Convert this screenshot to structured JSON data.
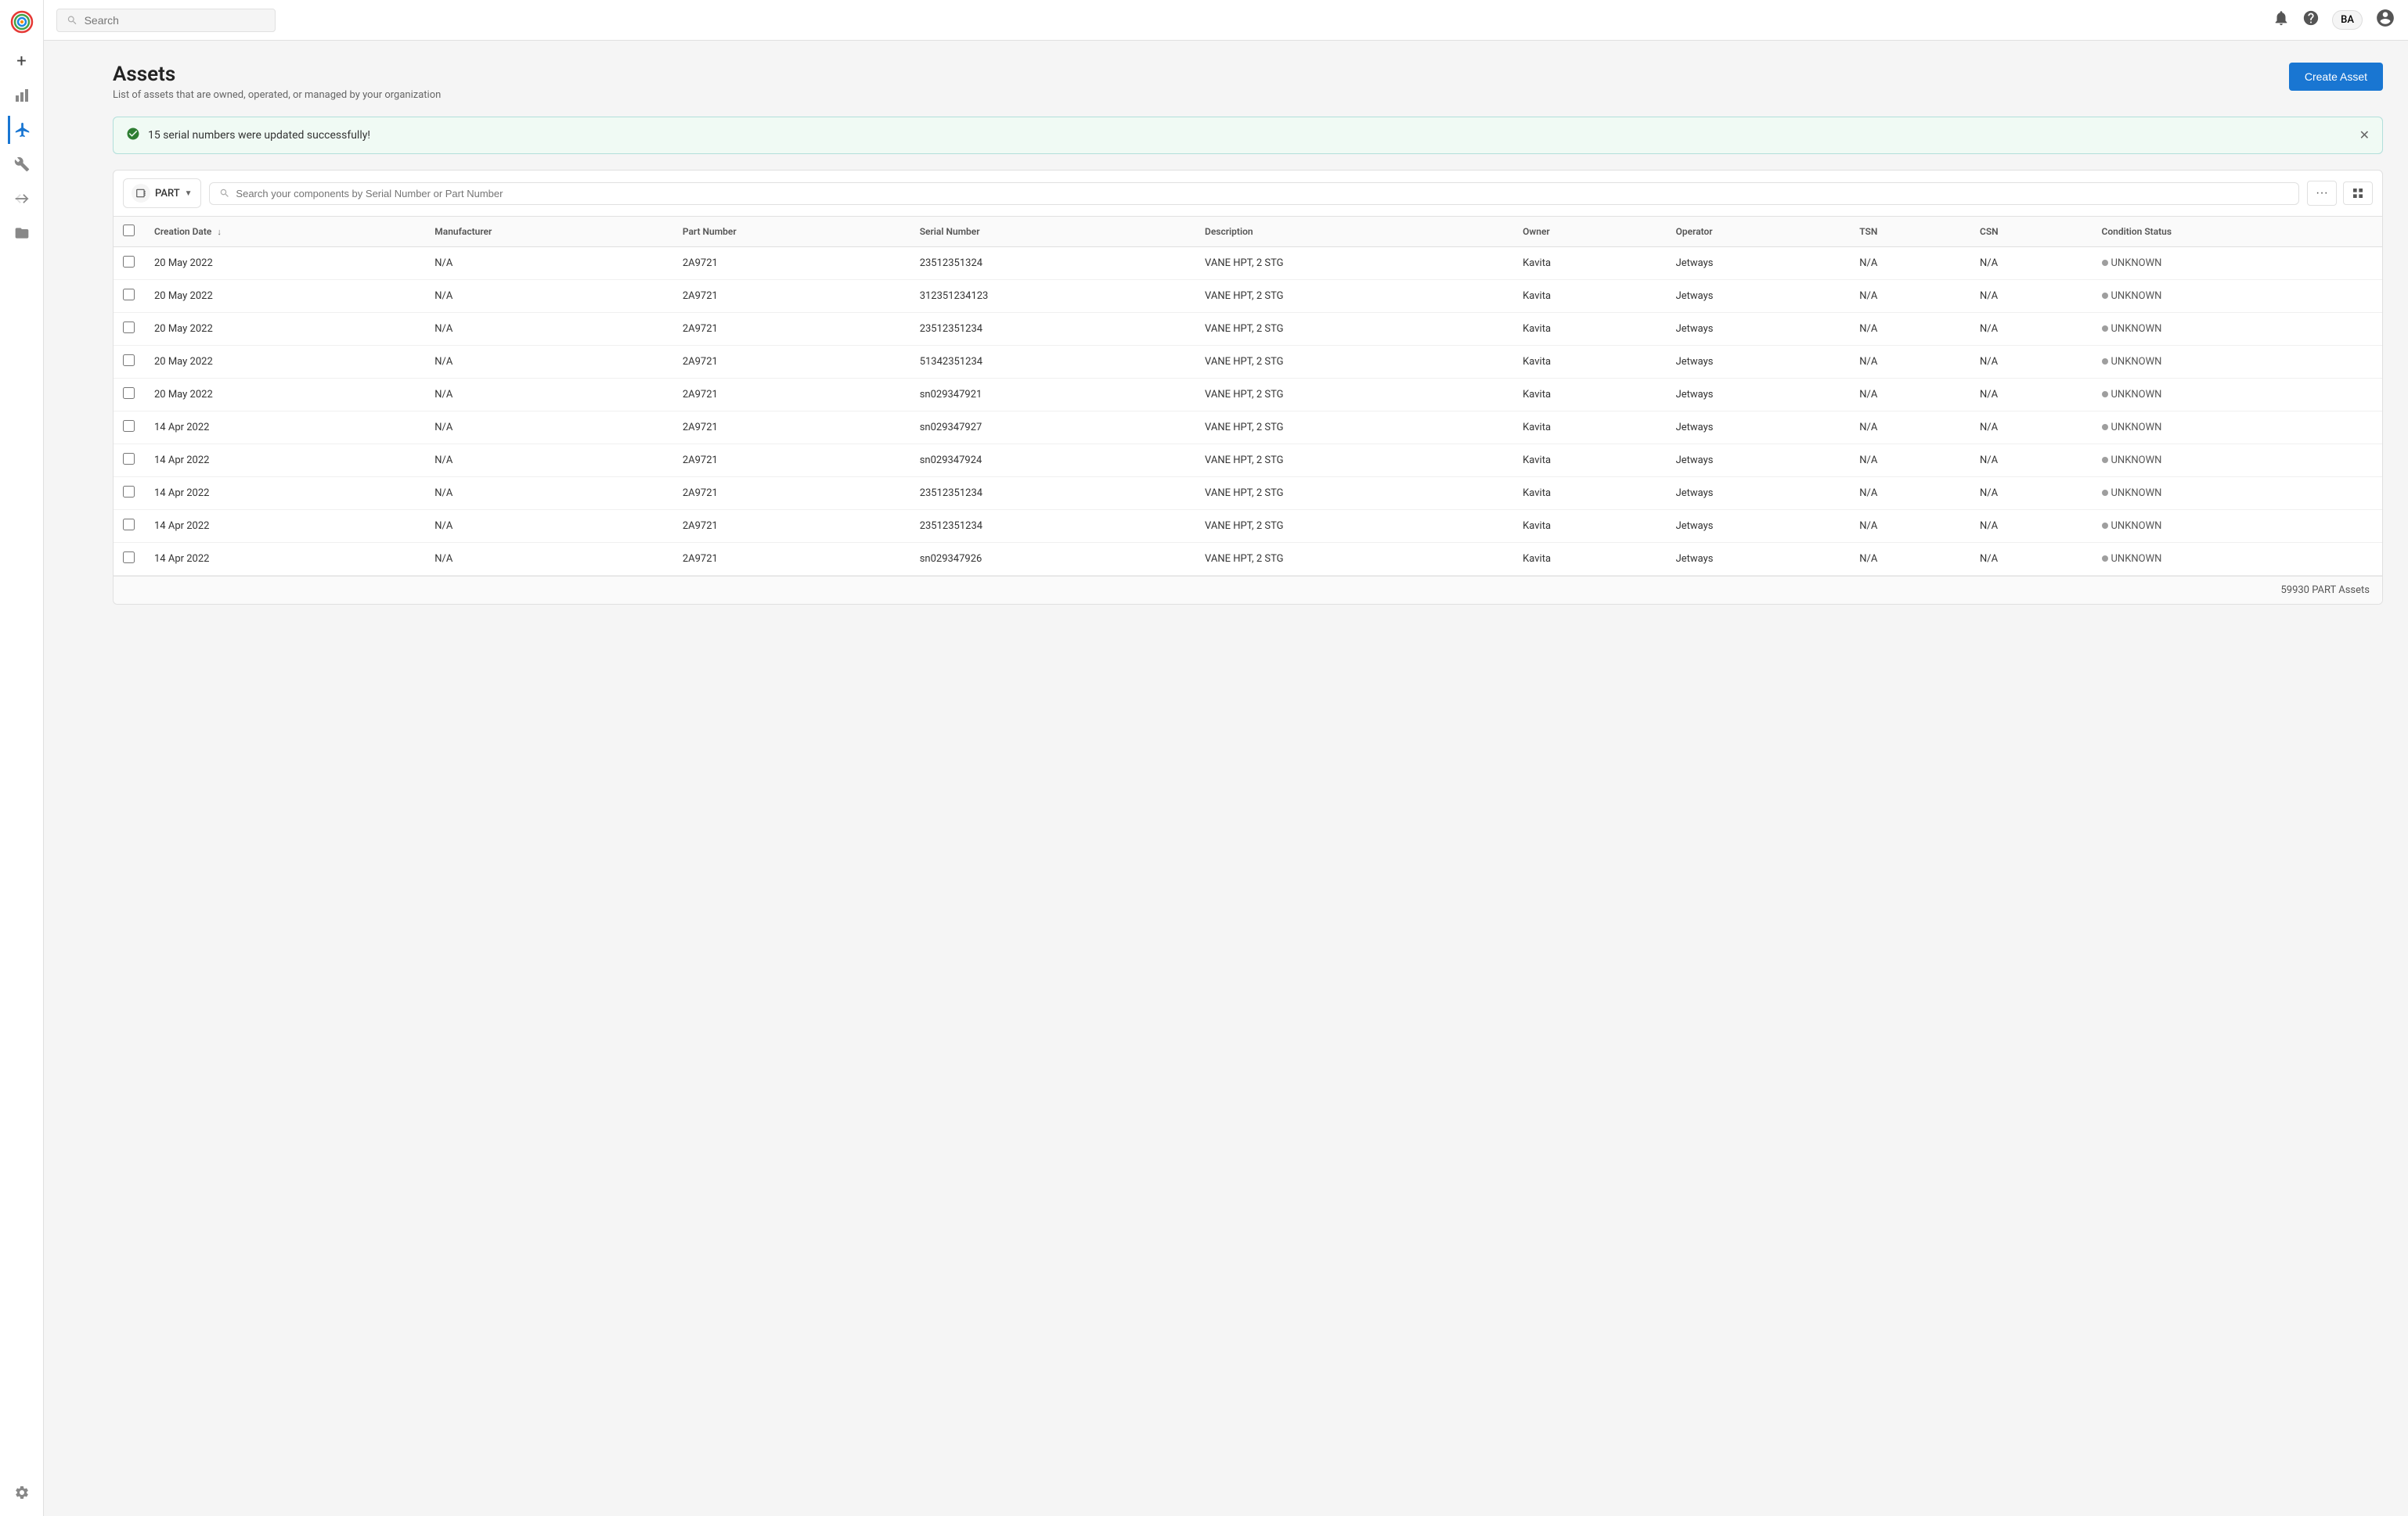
{
  "app": {
    "title": "Assets",
    "subtitle": "List of assets that are owned, operated, or managed by your organization"
  },
  "topbar": {
    "search_placeholder": "Search",
    "user_initials": "BA"
  },
  "sidebar": {
    "items": [
      {
        "id": "add",
        "icon": "+",
        "label": "Add"
      },
      {
        "id": "analytics",
        "icon": "📊",
        "label": "Analytics"
      },
      {
        "id": "flights",
        "icon": "✈",
        "label": "Flights",
        "active": true
      },
      {
        "id": "tools",
        "icon": "🔧",
        "label": "Tools"
      },
      {
        "id": "connections",
        "icon": "⇄",
        "label": "Connections"
      },
      {
        "id": "files",
        "icon": "📁",
        "label": "Files"
      },
      {
        "id": "settings",
        "icon": "⚙",
        "label": "Settings"
      }
    ]
  },
  "create_button": "Create Asset",
  "success_banner": {
    "message": "15 serial numbers were updated successfully!"
  },
  "toolbar": {
    "asset_type": "PART",
    "search_placeholder": "Search your components by Serial Number or Part Number",
    "more_options": "···",
    "view_toggle": "⊞"
  },
  "table": {
    "columns": [
      {
        "id": "creation_date",
        "label": "Creation Date",
        "sortable": true,
        "sort_dir": "desc"
      },
      {
        "id": "manufacturer",
        "label": "Manufacturer"
      },
      {
        "id": "part_number",
        "label": "Part Number"
      },
      {
        "id": "serial_number",
        "label": "Serial Number"
      },
      {
        "id": "description",
        "label": "Description"
      },
      {
        "id": "owner",
        "label": "Owner"
      },
      {
        "id": "operator",
        "label": "Operator"
      },
      {
        "id": "tsn",
        "label": "TSN"
      },
      {
        "id": "csn",
        "label": "CSN"
      },
      {
        "id": "condition_status",
        "label": "Condition Status"
      }
    ],
    "rows": [
      {
        "creation_date": "20 May 2022",
        "manufacturer": "N/A",
        "part_number": "2A9721",
        "serial_number": "23512351324",
        "description": "VANE HPT, 2 STG",
        "owner": "Kavita",
        "operator": "Jetways",
        "tsn": "N/A",
        "csn": "N/A",
        "condition_status": "UNKNOWN"
      },
      {
        "creation_date": "20 May 2022",
        "manufacturer": "N/A",
        "part_number": "2A9721",
        "serial_number": "312351234123",
        "description": "VANE HPT, 2 STG",
        "owner": "Kavita",
        "operator": "Jetways",
        "tsn": "N/A",
        "csn": "N/A",
        "condition_status": "UNKNOWN"
      },
      {
        "creation_date": "20 May 2022",
        "manufacturer": "N/A",
        "part_number": "2A9721",
        "serial_number": "23512351234",
        "description": "VANE HPT, 2 STG",
        "owner": "Kavita",
        "operator": "Jetways",
        "tsn": "N/A",
        "csn": "N/A",
        "condition_status": "UNKNOWN"
      },
      {
        "creation_date": "20 May 2022",
        "manufacturer": "N/A",
        "part_number": "2A9721",
        "serial_number": "51342351234",
        "description": "VANE HPT, 2 STG",
        "owner": "Kavita",
        "operator": "Jetways",
        "tsn": "N/A",
        "csn": "N/A",
        "condition_status": "UNKNOWN"
      },
      {
        "creation_date": "20 May 2022",
        "manufacturer": "N/A",
        "part_number": "2A9721",
        "serial_number": "sn029347921",
        "description": "VANE HPT, 2 STG",
        "owner": "Kavita",
        "operator": "Jetways",
        "tsn": "N/A",
        "csn": "N/A",
        "condition_status": "UNKNOWN"
      },
      {
        "creation_date": "14 Apr 2022",
        "manufacturer": "N/A",
        "part_number": "2A9721",
        "serial_number": "sn029347927",
        "description": "VANE HPT, 2 STG",
        "owner": "Kavita",
        "operator": "Jetways",
        "tsn": "N/A",
        "csn": "N/A",
        "condition_status": "UNKNOWN"
      },
      {
        "creation_date": "14 Apr 2022",
        "manufacturer": "N/A",
        "part_number": "2A9721",
        "serial_number": "sn029347924",
        "description": "VANE HPT, 2 STG",
        "owner": "Kavita",
        "operator": "Jetways",
        "tsn": "N/A",
        "csn": "N/A",
        "condition_status": "UNKNOWN"
      },
      {
        "creation_date": "14 Apr 2022",
        "manufacturer": "N/A",
        "part_number": "2A9721",
        "serial_number": "23512351234",
        "description": "VANE HPT, 2 STG",
        "owner": "Kavita",
        "operator": "Jetways",
        "tsn": "N/A",
        "csn": "N/A",
        "condition_status": "UNKNOWN"
      },
      {
        "creation_date": "14 Apr 2022",
        "manufacturer": "N/A",
        "part_number": "2A9721",
        "serial_number": "23512351234",
        "description": "VANE HPT, 2 STG",
        "owner": "Kavita",
        "operator": "Jetways",
        "tsn": "N/A",
        "csn": "N/A",
        "condition_status": "UNKNOWN"
      },
      {
        "creation_date": "14 Apr 2022",
        "manufacturer": "N/A",
        "part_number": "2A9721",
        "serial_number": "sn029347926",
        "description": "VANE HPT, 2 STG",
        "owner": "Kavita",
        "operator": "Jetways",
        "tsn": "N/A",
        "csn": "N/A",
        "condition_status": "UNKNOWN"
      }
    ],
    "footer": "59930 PART Assets"
  }
}
